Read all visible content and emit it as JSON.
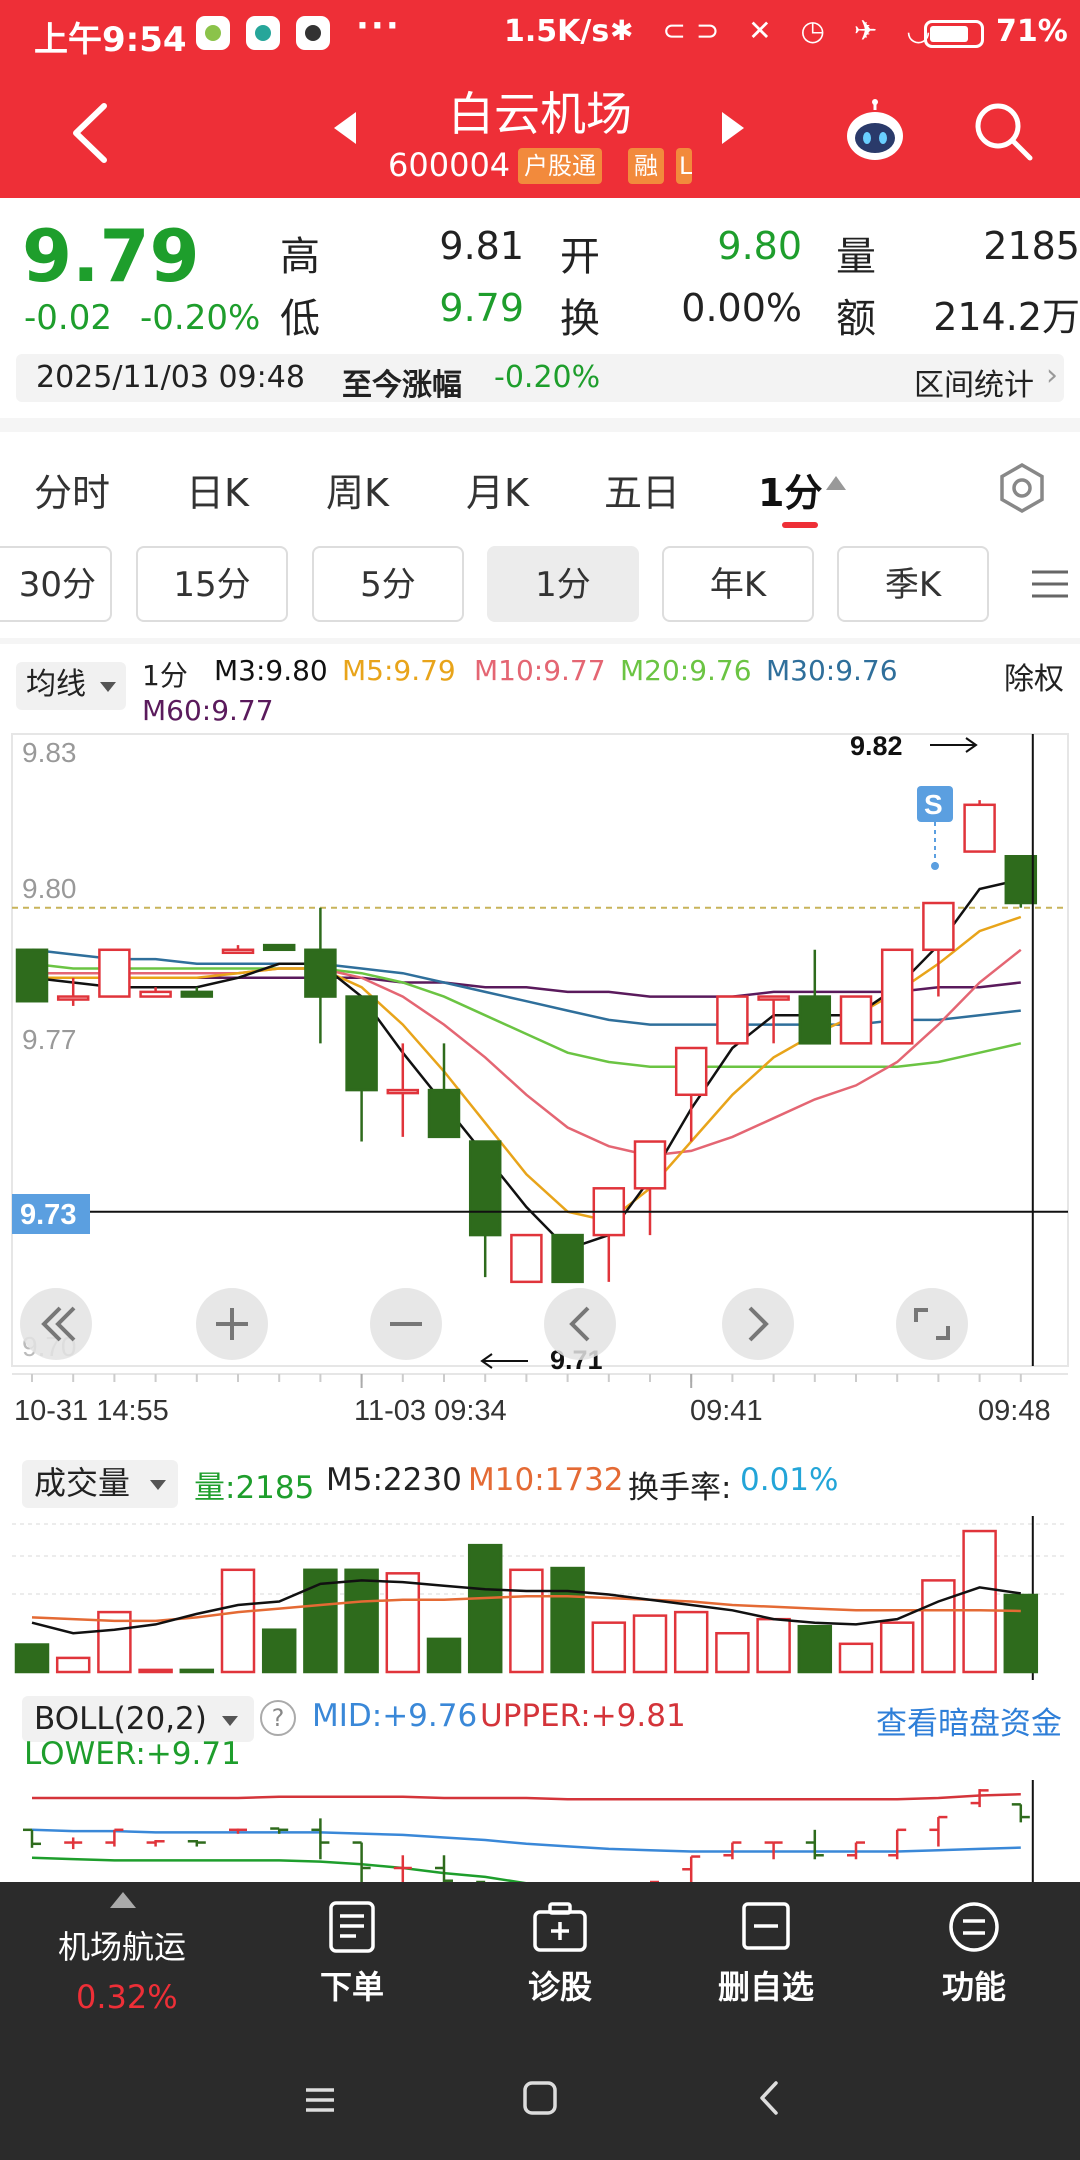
{
  "statusbar": {
    "time": "上午9:54",
    "dots": "···",
    "speed": "1.5K/s",
    "icons": "✱ ⊂⊃ ✕ ◷ ✈ ◡",
    "battery": "71%"
  },
  "header": {
    "name": "白云机场",
    "code": "600004",
    "tag_hgt": "户股通",
    "tag_rong": "融",
    "tag_l": "L"
  },
  "quote": {
    "price": "9.79",
    "change": "-0.02",
    "change_pct": "-0.20%",
    "high_label": "高",
    "high": "9.81",
    "low_label": "低",
    "low": "9.79",
    "open_label": "开",
    "open": "9.80",
    "turn_label": "换",
    "turn": "0.00%",
    "vol_label": "量",
    "vol": "2185",
    "amt_label": "额",
    "amt": "214.2万"
  },
  "info": {
    "datetime": "2025/11/03 09:48",
    "since_label": "至今涨幅",
    "since_pct": "-0.20%",
    "range_stat": "区间统计",
    "range_arrow": "›"
  },
  "period_tabs": [
    "分时",
    "日K",
    "周K",
    "月K",
    "五日",
    "1分"
  ],
  "sub_tabs": [
    "30分",
    "15分",
    "5分",
    "1分",
    "年K",
    "季K"
  ],
  "ma": {
    "type": "均线",
    "period": "1分",
    "m3": "M3:9.80",
    "m5": "M5:9.79",
    "m10": "M10:9.77",
    "m20": "M20:9.76",
    "m30": "M30:9.76",
    "m60": "M60:9.77",
    "adj": "除权"
  },
  "colors": {
    "up": "#e0343b",
    "down": "#2e6b1c",
    "m3": "#111111",
    "m5": "#e8a41a",
    "m10": "#e46673",
    "m20": "#6bc443",
    "m30": "#2f6f9b",
    "m60": "#5a1a5c"
  },
  "chart_data": {
    "type": "candlestick",
    "y_ticks": [
      "9.83",
      "9.80",
      "9.77",
      "9.73",
      "9.70"
    ],
    "ylim": [
      9.7,
      9.83
    ],
    "x_labels": [
      "10-31 14:55",
      "11-03 09:34",
      "09:41",
      "09:48"
    ],
    "crosshair_price": "9.73",
    "crosshair_value": 9.73,
    "ref_price": 9.795,
    "max_label": "9.82",
    "min_label": "9.71",
    "sell_marker": "S",
    "candles": [
      {
        "o": 9.786,
        "h": 9.786,
        "l": 9.775,
        "c": 9.775
      },
      {
        "o": 9.776,
        "h": 9.78,
        "l": 9.774,
        "c": 9.776
      },
      {
        "o": 9.776,
        "h": 9.786,
        "l": 9.776,
        "c": 9.786
      },
      {
        "o": 9.776,
        "h": 9.778,
        "l": 9.776,
        "c": 9.777
      },
      {
        "o": 9.777,
        "h": 9.778,
        "l": 9.776,
        "c": 9.776
      },
      {
        "o": 9.786,
        "h": 9.787,
        "l": 9.786,
        "c": 9.786
      },
      {
        "o": 9.787,
        "h": 9.787,
        "l": 9.786,
        "c": 9.786
      },
      {
        "o": 9.786,
        "h": 9.795,
        "l": 9.766,
        "c": 9.776
      },
      {
        "o": 9.776,
        "h": 9.776,
        "l": 9.745,
        "c": 9.756
      },
      {
        "o": 9.756,
        "h": 9.766,
        "l": 9.746,
        "c": 9.756
      },
      {
        "o": 9.756,
        "h": 9.766,
        "l": 9.746,
        "c": 9.746
      },
      {
        "o": 9.745,
        "h": 9.745,
        "l": 9.716,
        "c": 9.725
      },
      {
        "o": 9.715,
        "h": 9.725,
        "l": 9.715,
        "c": 9.725
      },
      {
        "o": 9.725,
        "h": 9.725,
        "l": 9.715,
        "c": 9.715
      },
      {
        "o": 9.725,
        "h": 9.735,
        "l": 9.715,
        "c": 9.735
      },
      {
        "o": 9.735,
        "h": 9.745,
        "l": 9.725,
        "c": 9.745
      },
      {
        "o": 9.755,
        "h": 9.765,
        "l": 9.745,
        "c": 9.765
      },
      {
        "o": 9.766,
        "h": 9.776,
        "l": 9.766,
        "c": 9.776
      },
      {
        "o": 9.776,
        "h": 9.776,
        "l": 9.766,
        "c": 9.776
      },
      {
        "o": 9.776,
        "h": 9.786,
        "l": 9.766,
        "c": 9.766
      },
      {
        "o": 9.766,
        "h": 9.776,
        "l": 9.766,
        "c": 9.776
      },
      {
        "o": 9.766,
        "h": 9.786,
        "l": 9.766,
        "c": 9.786
      },
      {
        "o": 9.786,
        "h": 9.796,
        "l": 9.776,
        "c": 9.796
      },
      {
        "o": 9.807,
        "h": 9.818,
        "l": 9.807,
        "c": 9.817
      },
      {
        "o": 9.806,
        "h": 9.806,
        "l": 9.795,
        "c": 9.796
      }
    ],
    "ma3": [
      9.78,
      9.779,
      9.778,
      9.778,
      9.778,
      9.78,
      9.783,
      9.783,
      9.776,
      9.764,
      9.753,
      9.742,
      9.731,
      9.722,
      9.725,
      9.737,
      9.752,
      9.765,
      9.772,
      9.772,
      9.772,
      9.778,
      9.787,
      9.799,
      9.801
    ],
    "ma5": [
      9.78,
      9.78,
      9.78,
      9.78,
      9.78,
      9.781,
      9.782,
      9.782,
      9.778,
      9.77,
      9.76,
      9.749,
      9.738,
      9.73,
      9.728,
      9.735,
      9.745,
      9.755,
      9.763,
      9.768,
      9.772,
      9.777,
      9.783,
      9.79,
      9.793
    ],
    "ma10": [
      9.781,
      9.781,
      9.781,
      9.781,
      9.781,
      9.781,
      9.782,
      9.782,
      9.78,
      9.776,
      9.77,
      9.763,
      9.755,
      9.748,
      9.744,
      9.742,
      9.743,
      9.746,
      9.75,
      9.754,
      9.757,
      9.762,
      9.77,
      9.779,
      9.786
    ],
    "ma20": [
      9.783,
      9.782,
      9.782,
      9.782,
      9.782,
      9.782,
      9.782,
      9.782,
      9.781,
      9.779,
      9.776,
      9.772,
      9.768,
      9.764,
      9.762,
      9.761,
      9.761,
      9.761,
      9.761,
      9.761,
      9.761,
      9.761,
      9.762,
      9.764,
      9.766
    ],
    "ma30": [
      9.786,
      9.785,
      9.784,
      9.784,
      9.783,
      9.783,
      9.783,
      9.783,
      9.782,
      9.781,
      9.779,
      9.777,
      9.775,
      9.773,
      9.771,
      9.77,
      9.77,
      9.77,
      9.77,
      9.77,
      9.77,
      9.771,
      9.771,
      9.772,
      9.773
    ],
    "ma60": [
      9.78,
      9.78,
      9.78,
      9.78,
      9.78,
      9.78,
      9.78,
      9.78,
      9.78,
      9.779,
      9.779,
      9.778,
      9.778,
      9.777,
      9.777,
      9.776,
      9.776,
      9.776,
      9.777,
      9.777,
      9.777,
      9.777,
      9.778,
      9.778,
      9.779
    ],
    "volume": [
      780,
      400,
      1700,
      60,
      60,
      2900,
      1200,
      2900,
      2900,
      2800,
      940,
      3600,
      2900,
      2950,
      1400,
      1600,
      1700,
      1100,
      1500,
      1300,
      800,
      1400,
      2600,
      4000,
      2185
    ],
    "vol_m5": [
      1400,
      1100,
      1200,
      1350,
      1650,
      1900,
      2000,
      2500,
      2600,
      2550,
      2450,
      2350,
      2300,
      2300,
      2200,
      2050,
      1900,
      1750,
      1500,
      1400,
      1350,
      1500,
      2000,
      2400,
      2230
    ],
    "vol_m10": [
      1550,
      1500,
      1450,
      1450,
      1550,
      1700,
      1800,
      1900,
      2000,
      2050,
      2050,
      2100,
      2150,
      2150,
      2100,
      2050,
      2000,
      1900,
      1850,
      1800,
      1750,
      1750,
      1750,
      1750,
      1732
    ],
    "vol_max": 4200,
    "boll_upper": [
      9.811,
      9.811,
      9.811,
      9.811,
      9.811,
      9.811,
      9.812,
      9.812,
      9.812,
      9.812,
      9.811,
      9.811,
      9.811,
      9.81,
      9.81,
      9.81,
      9.81,
      9.81,
      9.81,
      9.81,
      9.81,
      9.81,
      9.811,
      9.813,
      9.814
    ],
    "boll_mid": [
      9.786,
      9.785,
      9.785,
      9.784,
      9.784,
      9.784,
      9.784,
      9.784,
      9.783,
      9.782,
      9.78,
      9.778,
      9.775,
      9.773,
      9.771,
      9.77,
      9.769,
      9.769,
      9.769,
      9.769,
      9.769,
      9.769,
      9.77,
      9.771,
      9.772
    ],
    "boll_lower": [
      9.764,
      9.763,
      9.762,
      9.762,
      9.762,
      9.762,
      9.762,
      9.761,
      9.759,
      9.756,
      9.752,
      9.749,
      9.744,
      9.741,
      9.738,
      9.736,
      9.735,
      9.734,
      9.734,
      9.734,
      9.734,
      9.734,
      9.735,
      9.736,
      9.737
    ]
  },
  "volume_panel": {
    "type": "成交量",
    "qty": "量:2185",
    "m5": "M5:2230",
    "m10": "M10:1732",
    "turn_label": "换手率:",
    "turn_value": "0.01%"
  },
  "boll_panel": {
    "type": "BOLL(20,2)",
    "help": "?",
    "mid": "MID:+9.76",
    "upper": "UPPER:+9.81",
    "lower": "LOWER:+9.71",
    "dark_pool": "查看暗盘资金"
  },
  "bottom_bar": {
    "sector_name": "机场航运",
    "sector_pct": "0.32%",
    "order": "下单",
    "diagnose": "诊股",
    "del_fav": "删自选",
    "function": "功能"
  }
}
